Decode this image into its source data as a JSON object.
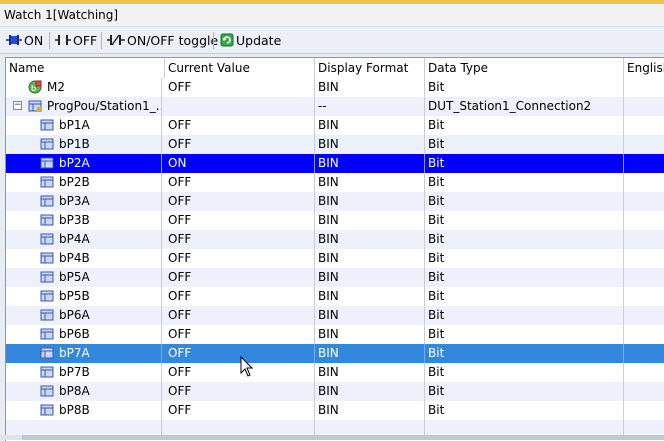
{
  "window": {
    "title": "Watch 1[Watching]"
  },
  "toolbar": {
    "on_label": "ON",
    "off_label": "OFF",
    "toggle_label": "ON/OFF toggle",
    "update_label": "Update"
  },
  "columns": [
    "Name",
    "Current Value",
    "Display Format",
    "Data Type",
    "English"
  ],
  "rows": [
    {
      "name": "M2",
      "value": "OFF",
      "format": "BIN",
      "type": "Bit",
      "english": ""
    },
    {
      "name": "ProgPou/Station1_...",
      "value": "",
      "format": "--",
      "type": "DUT_Station1_Connection2",
      "english": ""
    },
    {
      "name": "bP1A",
      "value": "OFF",
      "format": "BIN",
      "type": "Bit",
      "english": ""
    },
    {
      "name": "bP1B",
      "value": "OFF",
      "format": "BIN",
      "type": "Bit",
      "english": ""
    },
    {
      "name": "bP2A",
      "value": "ON",
      "format": "BIN",
      "type": "Bit",
      "english": ""
    },
    {
      "name": "bP2B",
      "value": "OFF",
      "format": "BIN",
      "type": "Bit",
      "english": ""
    },
    {
      "name": "bP3A",
      "value": "OFF",
      "format": "BIN",
      "type": "Bit",
      "english": ""
    },
    {
      "name": "bP3B",
      "value": "OFF",
      "format": "BIN",
      "type": "Bit",
      "english": ""
    },
    {
      "name": "bP4A",
      "value": "OFF",
      "format": "BIN",
      "type": "Bit",
      "english": ""
    },
    {
      "name": "bP4B",
      "value": "OFF",
      "format": "BIN",
      "type": "Bit",
      "english": ""
    },
    {
      "name": "bP5A",
      "value": "OFF",
      "format": "BIN",
      "type": "Bit",
      "english": ""
    },
    {
      "name": "bP5B",
      "value": "OFF",
      "format": "BIN",
      "type": "Bit",
      "english": ""
    },
    {
      "name": "bP6A",
      "value": "OFF",
      "format": "BIN",
      "type": "Bit",
      "english": ""
    },
    {
      "name": "bP6B",
      "value": "OFF",
      "format": "BIN",
      "type": "Bit",
      "english": ""
    },
    {
      "name": "bP7A",
      "value": "OFF",
      "format": "BIN",
      "type": "Bit",
      "english": ""
    },
    {
      "name": "bP7B",
      "value": "OFF",
      "format": "BIN",
      "type": "Bit",
      "english": ""
    },
    {
      "name": "bP8A",
      "value": "OFF",
      "format": "BIN",
      "type": "Bit",
      "english": ""
    },
    {
      "name": "bP8B",
      "value": "OFF",
      "format": "BIN",
      "type": "Bit",
      "english": ""
    },
    {
      "name": "",
      "value": "",
      "format": "",
      "type": "",
      "english": ""
    }
  ],
  "colors": {
    "selected_on_row": "#0000ff",
    "selected_row": "#3388dd",
    "alt_row": "#eef1fb",
    "title_accent": "#f3c34a"
  }
}
